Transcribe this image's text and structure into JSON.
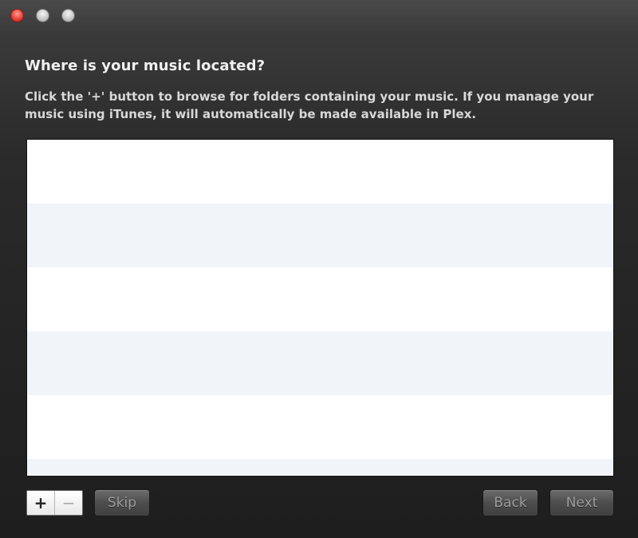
{
  "window": {
    "controls": {
      "close": "close-icon",
      "minimize": "minimize-icon",
      "zoom": "zoom-icon"
    }
  },
  "content": {
    "heading": "Where is your music located?",
    "description": "Click the '+' button to browse for folders containing your music. If you manage your music using iTunes, it will automatically be made available in Plex."
  },
  "folder_list": {
    "items": []
  },
  "footer": {
    "add_label": "+",
    "remove_label": "−",
    "skip_label": "Skip",
    "back_label": "Back",
    "next_label": "Next"
  },
  "colors": {
    "close_button": "#e9433a",
    "list_background": "#ffffff",
    "list_alt_row": "#f1f4f9"
  }
}
